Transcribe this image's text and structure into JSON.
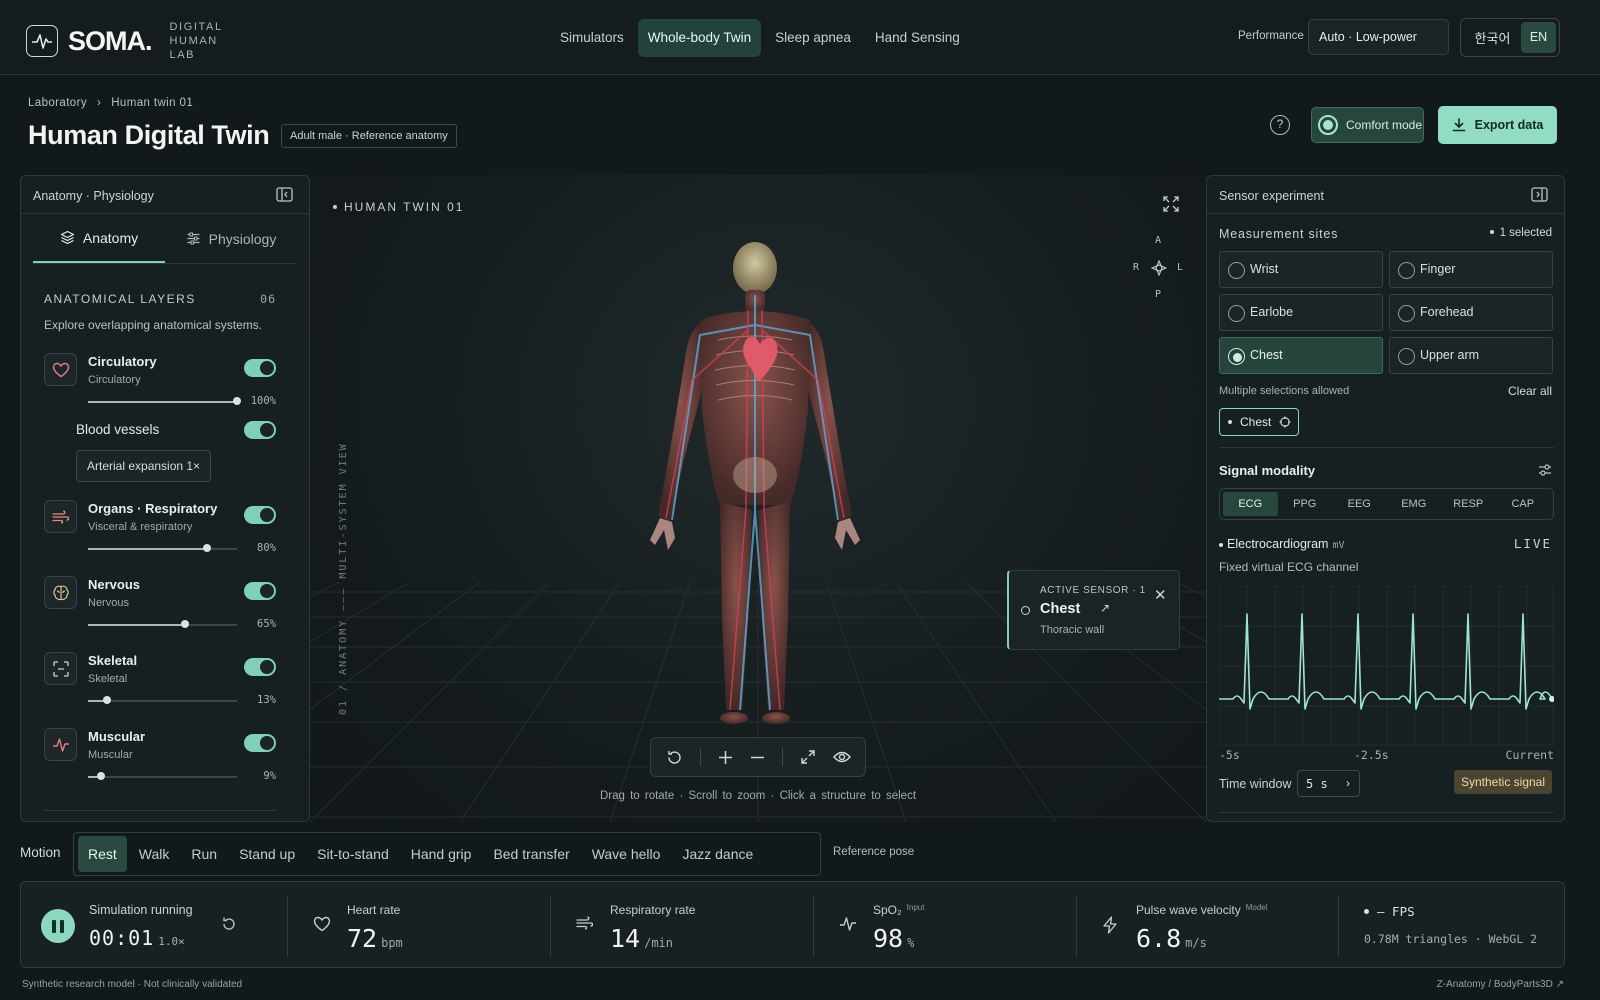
{
  "brand": {
    "name": "SOMA.",
    "sub_line1": "DIGITAL HUMAN",
    "sub_line2": "LAB"
  },
  "nav": [
    {
      "label": "Simulators"
    },
    {
      "label": "Whole-body Twin",
      "active": true
    },
    {
      "label": "Sleep apnea"
    },
    {
      "label": "Hand Sensing"
    }
  ],
  "performance": {
    "label": "Performance",
    "value": "Auto · Low-power"
  },
  "language": {
    "ko": "한국어",
    "en": "EN",
    "selected": "EN"
  },
  "breadcrumb": {
    "root": "Laboratory",
    "separator": "›",
    "current": "Human twin 01"
  },
  "page": {
    "title": "Human Digital Twin",
    "tag": "Adult male · Reference anatomy"
  },
  "actions": {
    "help": "?",
    "comfort": "Comfort mode",
    "export": "Export data"
  },
  "left_panel": {
    "header": "Anatomy · Physiology",
    "tabs": [
      {
        "label": "Anatomy",
        "active": true
      },
      {
        "label": "Physiology"
      }
    ],
    "section_title": "ANATOMICAL LAYERS",
    "section_count": "06",
    "section_desc": "Explore overlapping anatomical systems.",
    "layers": [
      {
        "name": "Circulatory",
        "sub": "Circulatory",
        "on": true,
        "opacity": 100,
        "opacity_label": "100%",
        "icon": "heart-icon"
      },
      {
        "name": "Organs · Respiratory",
        "sub": "Visceral & respiratory",
        "on": true,
        "opacity": 80,
        "opacity_label": "80%",
        "icon": "wind-icon"
      },
      {
        "name": "Nervous",
        "sub": "Nervous",
        "on": true,
        "opacity": 65,
        "opacity_label": "65%",
        "icon": "brain-icon"
      },
      {
        "name": "Skeletal",
        "sub": "Skeletal",
        "on": true,
        "opacity": 13,
        "opacity_label": "13%",
        "icon": "scan-icon"
      },
      {
        "name": "Muscular",
        "sub": "Muscular",
        "on": true,
        "opacity": 9,
        "opacity_label": "9%",
        "icon": "pulse-icon"
      }
    ],
    "blood_vessels": {
      "label": "Blood vessels",
      "on": true,
      "expansion": "Arterial expansion 1×"
    }
  },
  "viewport": {
    "label": "HUMAN TWIN 01",
    "vertical_text": "01 / ANATOMY ——— MULTI-SYSTEM VIEW",
    "compass": {
      "a": "A",
      "p": "P",
      "r": "R",
      "l": "L"
    },
    "sensor_popup": {
      "kicker": "ACTIVE SENSOR · 1",
      "name": "Chest",
      "sub": "Thoracic wall"
    },
    "hints": "Drag to rotate  ·  Scroll to zoom  ·  Click a structure to select"
  },
  "right_panel": {
    "header": "Sensor experiment",
    "sites_title": "Measurement sites",
    "sites_selected": "1 selected",
    "sites": [
      {
        "label": "Wrist",
        "on": false
      },
      {
        "label": "Finger",
        "on": false
      },
      {
        "label": "Earlobe",
        "on": false
      },
      {
        "label": "Forehead",
        "on": false
      },
      {
        "label": "Chest",
        "on": true
      },
      {
        "label": "Upper arm",
        "on": false
      }
    ],
    "multi_note": "Multiple selections allowed",
    "clear_all": "Clear all",
    "chip": "Chest",
    "modality_title": "Signal modality",
    "modalities": [
      {
        "label": "ECG",
        "active": true
      },
      {
        "label": "PPG"
      },
      {
        "label": "EEG"
      },
      {
        "label": "EMG"
      },
      {
        "label": "RESP"
      },
      {
        "label": "CAP"
      }
    ],
    "signal_name": "Electrocardiogram",
    "signal_unit": "mV",
    "live": "LIVE",
    "signal_desc": "Fixed virtual ECG channel",
    "ticks": [
      "-5s",
      "-2.5s",
      "Current"
    ],
    "time_window_label": "Time window",
    "time_window_value": "5 s",
    "synthetic": "Synthetic signal"
  },
  "motion": {
    "label": "Motion",
    "items": [
      {
        "label": "Rest",
        "active": true
      },
      {
        "label": "Walk"
      },
      {
        "label": "Run"
      },
      {
        "label": "Stand up"
      },
      {
        "label": "Sit-to-stand"
      },
      {
        "label": "Hand grip"
      },
      {
        "label": "Bed transfer"
      },
      {
        "label": "Wave hello"
      },
      {
        "label": "Jazz dance"
      }
    ],
    "reference": "Reference pose"
  },
  "status": {
    "sim_label": "Simulation running",
    "time": "00:01",
    "speed": "1.0×",
    "metrics": [
      {
        "label": "Heart rate",
        "tag": "",
        "value": "72",
        "unit": "bpm",
        "icon": "heart-icon"
      },
      {
        "label": "Respiratory rate",
        "tag": "",
        "value": "14",
        "unit": "/min",
        "icon": "wind-icon"
      },
      {
        "label": "SpO₂",
        "tag": "Input",
        "value": "98",
        "unit": "%",
        "icon": "pulse-icon"
      },
      {
        "label": "Pulse wave velocity",
        "tag": "Model",
        "value": "6.8",
        "unit": "m/s",
        "icon": "bolt-icon"
      }
    ],
    "fps": "– FPS",
    "triangles": "0.78M triangles · WebGL 2"
  },
  "footer": {
    "left": "Synthetic research model · Not clinically validated",
    "right": "Z-Anatomy / BodyParts3D ↗"
  },
  "colors": {
    "accent": "#8ed7bf",
    "active_bg": "#22433b",
    "background": "#12191b",
    "warning_tag": "#4a4430"
  }
}
